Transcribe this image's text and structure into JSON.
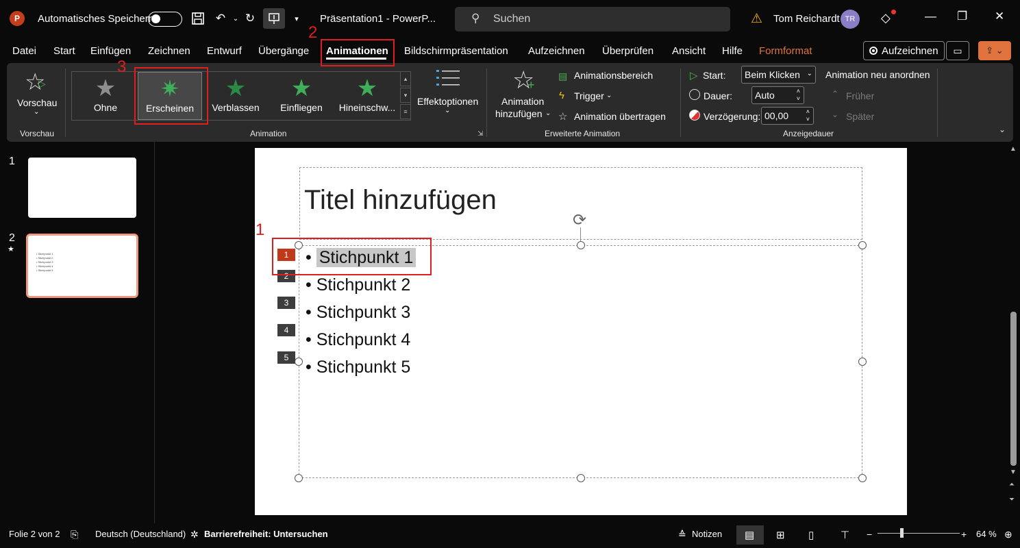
{
  "titlebar": {
    "autosave_label": "Automatisches Speichern",
    "doc_title": "Präsentation1  -  PowerP...",
    "search_placeholder": "Suchen",
    "user_name": "Tom Reichardt",
    "user_initials": "TR"
  },
  "menu": {
    "items": [
      "Datei",
      "Start",
      "Einfügen",
      "Zeichnen",
      "Entwurf",
      "Übergänge",
      "Animationen",
      "Bildschirmpräsentation",
      "Aufzeichnen",
      "Überprüfen",
      "Ansicht",
      "Hilfe",
      "Formformat"
    ],
    "active": "Animationen",
    "record_label": "Aufzeichnen",
    "formformat_color": "#e0733d"
  },
  "ribbon": {
    "preview": {
      "label": "Vorschau",
      "group": "Vorschau"
    },
    "gallery": {
      "items": [
        "Ohne",
        "Erscheinen",
        "Verblassen",
        "Einfliegen",
        "Hineinschw..."
      ],
      "selected": "Erscheinen"
    },
    "effect_options": "Effektoptionen",
    "animation_group": "Animation",
    "add_animation": [
      "Animation",
      "hinzufügen"
    ],
    "animation_pane": "Animationsbereich",
    "trigger": "Trigger",
    "animation_painter": "Animation übertragen",
    "advanced_group": "Erweiterte Animation",
    "start_label": "Start:",
    "start_value": "Beim Klicken",
    "duration_label": "Dauer:",
    "duration_value": "Auto",
    "delay_label": "Verzögerung:",
    "delay_value": "00,00",
    "reorder_title": "Animation neu anordnen",
    "earlier": "Früher",
    "later": "Später",
    "timing_group": "Anzeigedauer"
  },
  "slides_pane": {
    "slide1_number": "1",
    "slide2_number": "2",
    "slide2_lines": [
      "• Stichpunkt 1",
      "• Stichpunkt 2",
      "• Stichpunkt 3",
      "• Stichpunkt 4",
      "• Stichpunkt 5"
    ]
  },
  "slide": {
    "title": "Titel hinzufügen",
    "bullets": [
      "Stichpunkt 1",
      "Stichpunkt 2",
      "Stichpunkt 3",
      "Stichpunkt 4",
      "Stichpunkt 5"
    ],
    "anim_tags": [
      "1",
      "2",
      "3",
      "4",
      "5"
    ],
    "active_tag_color": "#c0391b"
  },
  "annotations": {
    "step1": "1",
    "step2": "2",
    "step3": "3",
    "color": "#e01e1e"
  },
  "status": {
    "slide_info": "Folie 2 von 2",
    "language": "Deutsch (Deutschland)",
    "accessibility": "Barrierefreiheit: Untersuchen",
    "notes": "Notizen",
    "zoom": "64 %"
  }
}
